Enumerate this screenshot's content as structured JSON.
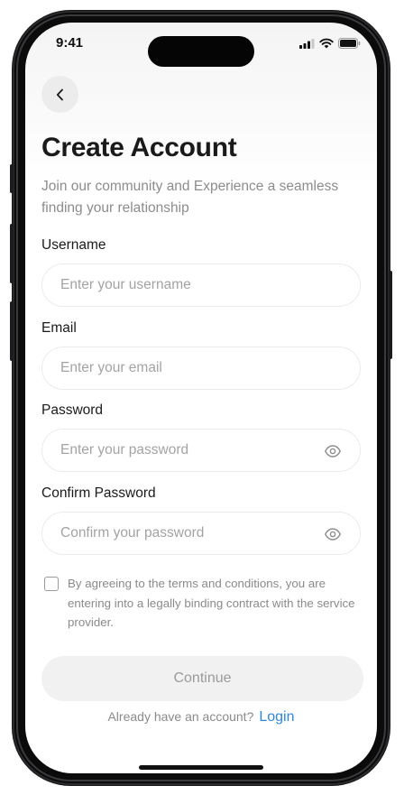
{
  "status_bar": {
    "time": "9:41",
    "icons": [
      "signal-icon",
      "wifi-icon",
      "battery-icon"
    ]
  },
  "header": {
    "back_icon": "chevron-left-icon",
    "title": "Create Account",
    "subtitle": "Join our community and Experience a seamless finding your relationship"
  },
  "form": {
    "username": {
      "label": "Username",
      "placeholder": "Enter your username",
      "value": ""
    },
    "email": {
      "label": "Email",
      "placeholder": "Enter your email",
      "value": ""
    },
    "password": {
      "label": "Password",
      "placeholder": "Enter your password",
      "value": "",
      "toggle_icon": "eye-icon"
    },
    "confirm_password": {
      "label": "Confirm Password",
      "placeholder": "Confirm your password",
      "value": "",
      "toggle_icon": "eye-icon"
    },
    "terms": {
      "checked": false,
      "text": "By agreeing to the terms and conditions, you are entering into a legally binding contract with the service provider."
    },
    "continue_label": "Continue"
  },
  "footer": {
    "prompt": "Already have an account?",
    "login_label": "Login"
  },
  "colors": {
    "accent": "#2f86d8",
    "title": "#1a1a1a",
    "muted": "#8c8c8c",
    "button_bg": "#f1f1f1"
  }
}
